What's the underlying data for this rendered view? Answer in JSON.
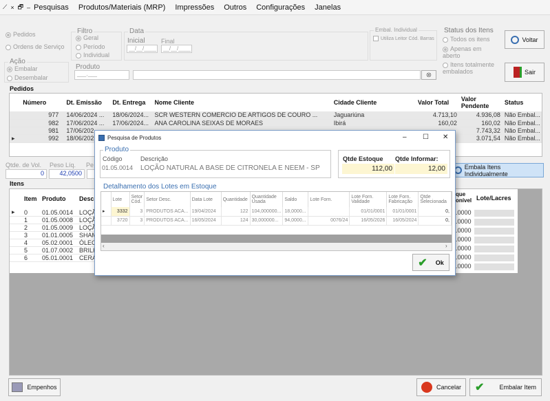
{
  "menu": {
    "pin": "⟋",
    "close": "×",
    "restore": "🗗",
    "minimize": "–",
    "items": [
      "Pesquisas",
      "Produtos/Materiais (MRP)",
      "Impressões",
      "Outros",
      "Configurações",
      "Janelas"
    ]
  },
  "tipo": {
    "pedidos": "Pedidos",
    "ordens": "Ordens de Serviço"
  },
  "filtro": {
    "title": "Filtro",
    "geral": "Geral",
    "periodo": "Período",
    "individual": "Individual"
  },
  "data": {
    "title": "Data",
    "inicial": "Inicial",
    "final": "Final",
    "date_mask": "__/__/____"
  },
  "acao": {
    "title": "Ação",
    "embalar": "Embalar",
    "desembalar": "Desembalar"
  },
  "produto": {
    "title": "Produto",
    "code_mask": "___.___"
  },
  "embal": {
    "title": "Embal. Individual",
    "leitor": "Utiliza Leitor Cód. Barras"
  },
  "status": {
    "title": "Status dos Itens",
    "todos": "Todos os itens",
    "apenas": "Apenas em aberto",
    "totalmente": "Itens totalmente embalados"
  },
  "buttons": {
    "voltar": "Voltar",
    "sair": "Sair",
    "embala_individual": "Embala Itens Individualmente",
    "empenhos": "Empenhos",
    "cancelar": "Cancelar",
    "embalar_item": "Embalar Item"
  },
  "pedidos": {
    "title": "Pedidos",
    "headers": [
      "Número",
      "Dt. Emissão",
      "Dt. Entrega",
      "Nome Cliente",
      "Cidade Cliente",
      "Valor Total",
      "Valor Pendente",
      "Status"
    ],
    "rows": [
      [
        "977",
        "14/06/2024 ...",
        "18/06/2024...",
        "SCR WESTERN COMERCIO DE ARTIGOS DE COURO ...",
        "Jaguariúna",
        "4.713,10",
        "4.936,08",
        "Não Embal..."
      ],
      [
        "982",
        "17/06/2024 ...",
        "17/06/2024...",
        "ANA CAROLINA SEIXAS DE MORAES",
        "Ibirá",
        "160,02",
        "160,02",
        "Não Embal..."
      ],
      [
        "981",
        "17/06/202",
        "",
        "",
        "",
        "",
        "7.743,32",
        "Não Embal..."
      ],
      [
        "992",
        "18/06/202",
        "",
        "",
        "",
        "",
        "3.071,54",
        "Não Embal..."
      ]
    ]
  },
  "qtde": {
    "vol_label": "Qtde. de Vol.",
    "vol": "0",
    "peso_label": "Peso Líq.",
    "peso": "42,0500",
    "pe_label": "Pe"
  },
  "itens": {
    "title": "Itens",
    "headers": [
      "Item",
      "Produto",
      "Desc"
    ],
    "rows": [
      [
        "0",
        "01.05.0014",
        "LOÇÃ"
      ],
      [
        "1",
        "01.05.0008",
        "LOÇÃ"
      ],
      [
        "2",
        "01.05.0009",
        "LOÇÃ"
      ],
      [
        "3",
        "01.01.0005",
        "SHAM"
      ],
      [
        "4",
        "05.02.0001",
        "ÓLEO"
      ],
      [
        "5",
        "01.07.0002",
        "BRILH"
      ],
      [
        "6",
        "05.01.0001",
        "CERA"
      ]
    ],
    "right_headers": [
      "que onível",
      "Lote/Lacres"
    ],
    "right_values": [
      ".0000",
      ".0000",
      ".0000",
      ".0000",
      ".0000",
      ".0000",
      ".0000"
    ]
  },
  "dialog": {
    "title": "Pesquisa de Produtos",
    "minimize": "–",
    "maximize": "☐",
    "close": "✕",
    "produto_title": "Produto",
    "codigo_label": "Código",
    "descricao_label": "Descrição",
    "codigo": "01.05.0014",
    "descricao": "LOÇÃO NATURAL A BASE DE CITRONELA E NEEM - SP",
    "estoque_label": "Qtde Estoque",
    "informar_label": "Qtde Informar:",
    "estoque": "112,00",
    "informar": "12,00",
    "lotes_title": "Detalhamento dos Lotes em Estoque",
    "lote_headers": [
      "Lote",
      "Setor Cód.",
      "Setor Desc.",
      "Data Lote",
      "Quantidade",
      "Quantidade Usada",
      "Saldo",
      "Lote Forn.",
      "Lote Forn. Validade",
      "Lote Forn. Fabricação",
      "Qtde Selecionada"
    ],
    "lote_rows": [
      [
        "3332",
        "3",
        "PRODUTOS ACA...",
        "19/04/2024",
        "122",
        "104,000000...",
        "18,0000...",
        "",
        "01/01/0001",
        "01/01/0001",
        "0,"
      ],
      [
        "3720",
        "3",
        "PRODUTOS ACA...",
        "16/05/2024",
        "124",
        "30,000000...",
        "94,0000...",
        "0076/24",
        "16/05/2026",
        "16/05/2024",
        "0,"
      ]
    ],
    "ok": "Ok"
  },
  "colors": {
    "accent": "#3a6fb0",
    "highlight": "#fdf6d2",
    "selected_blue": "#cfe3f7"
  }
}
